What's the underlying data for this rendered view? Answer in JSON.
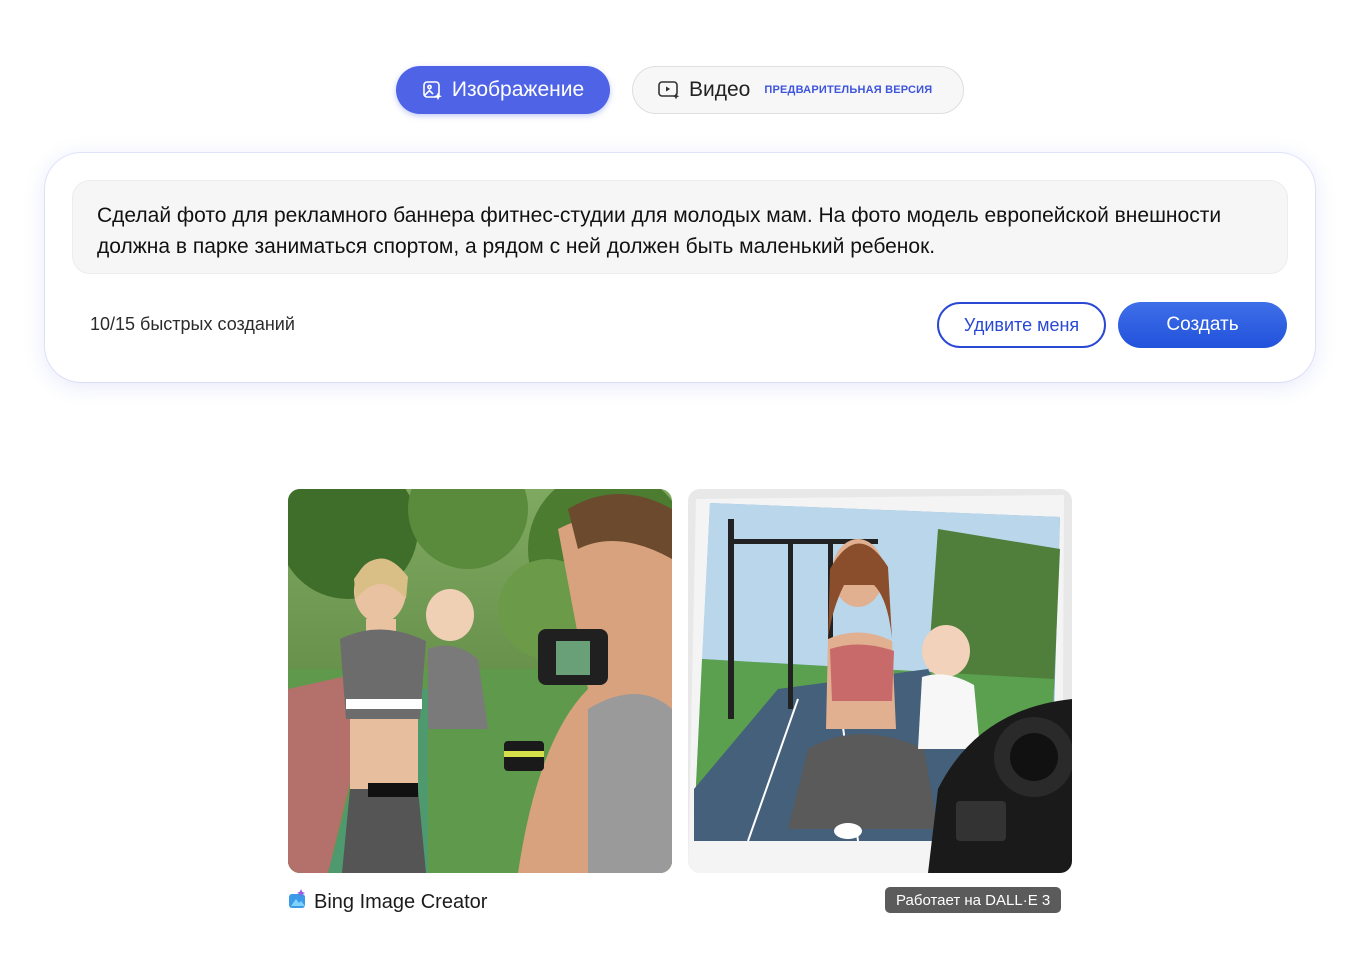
{
  "mode_tabs": {
    "image_label": "Изображение",
    "video_label": "Видео",
    "video_badge": "ПРЕДВАРИТЕЛЬНАЯ ВЕРСИЯ",
    "active": "image"
  },
  "prompt": {
    "text": "Сделай фото для рекламного баннера фитнес-студии для молодых мам. На фото модель европейской внешности должна в парке заниматься спортом, а рядом с ней должен быть маленький ребенок.",
    "quota": "10/15 быстрых созданий",
    "surprise_label": "Удивите меня",
    "create_label": "Создать"
  },
  "results": {
    "images": [
      {
        "alt": "generated-image-1",
        "icon": "photo"
      },
      {
        "alt": "generated-image-2",
        "icon": "photo"
      }
    ]
  },
  "footer": {
    "brand_name": "Bing Image Creator",
    "brand_icon": "image-creator-icon",
    "powered_by": "Работает на DALL·E 3"
  },
  "colors": {
    "accent": "#4e63e6",
    "button_blue": "#2a48d4",
    "badge_bg": "#5b5b5b"
  }
}
